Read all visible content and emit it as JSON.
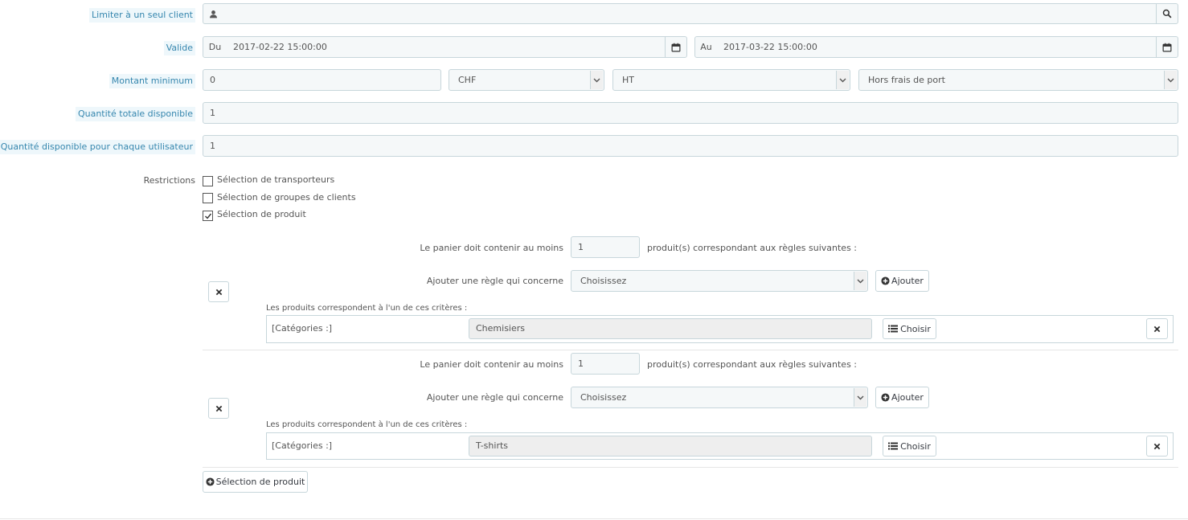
{
  "fields": {
    "client_label": "Limiter à un seul client",
    "client_value": "",
    "valid_label": "Valide",
    "from_prefix": "Du",
    "from_value": "2017-02-22 15:00:00",
    "to_prefix": "Au",
    "to_value": "2017-03-22 15:00:00",
    "min_amount_label": "Montant minimum",
    "min_amount_value": "0",
    "currency_value": "CHF",
    "tax_value": "HT",
    "shipping_value": "Hors frais de port",
    "total_qty_label": "Quantité totale disponible",
    "total_qty_value": "1",
    "user_qty_label": "Quantité disponible pour chaque utilisateur",
    "user_qty_value": "1"
  },
  "restrictions": {
    "label": "Restrictions",
    "items": [
      {
        "label": "Sélection de transporteurs",
        "checked": false
      },
      {
        "label": "Sélection de groupes de clients",
        "checked": false
      },
      {
        "label": "Sélection de produit",
        "checked": true
      }
    ]
  },
  "rule_groups": [
    {
      "min_prefix": "Le panier doit contenir au moins",
      "min_value": "1",
      "min_suffix": "produit(s) correspondant aux règles suivantes :",
      "add_rule_label": "Ajouter une règle qui concerne",
      "add_rule_select": "Choisissez",
      "add_button": "Ajouter",
      "criteria_caption": "Les produits correspondent à l'un de ces critères :",
      "rule_type": "[Catégories :]",
      "rule_value": "Chemisiers",
      "choose_button": "Choisir"
    },
    {
      "min_prefix": "Le panier doit contenir au moins",
      "min_value": "1",
      "min_suffix": "produit(s) correspondant aux règles suivantes :",
      "add_rule_label": "Ajouter une règle qui concerne",
      "add_rule_select": "Choisissez",
      "add_button": "Ajouter",
      "criteria_caption": "Les produits correspondent à l'un de ces critères :",
      "rule_type": "[Catégories :]",
      "rule_value": "T-shirts",
      "choose_button": "Choisir"
    }
  ],
  "add_product_selection_button": "Sélection de produit",
  "icons": {
    "user": "user-icon",
    "search": "search-icon",
    "calendar": "calendar-icon",
    "remove": "remove-x-icon",
    "plus": "plus-circle-icon",
    "list": "list-icon"
  }
}
